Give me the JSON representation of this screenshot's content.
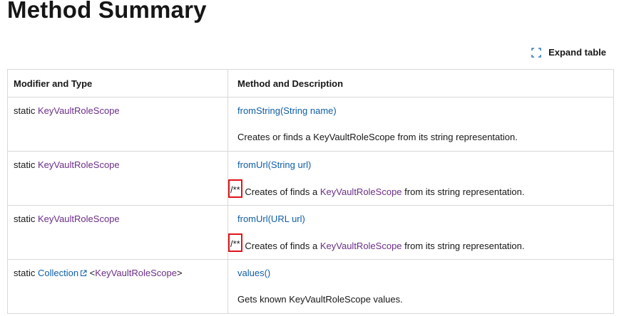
{
  "page": {
    "title": "Method Summary",
    "expand_label": "Expand table"
  },
  "table": {
    "headers": [
      "Modifier and Type",
      "Method and Description"
    ],
    "rows": [
      {
        "modifier": "static",
        "type": "KeyVaultRoleScope",
        "method": "fromString(String name)",
        "description": "Creates or finds a KeyVaultRoleScope from its string representation."
      },
      {
        "modifier": "static",
        "type": "KeyVaultRoleScope",
        "method": "fromUrl(String url)",
        "desc_prefix": "/**",
        "desc_before": " Creates of finds a ",
        "desc_link": "KeyVaultRoleScope",
        "desc_after": " from its string representation."
      },
      {
        "modifier": "static",
        "type": "KeyVaultRoleScope",
        "method": "fromUrl(URL url)",
        "desc_prefix": "/**",
        "desc_before": " Creates of finds a ",
        "desc_link": "KeyVaultRoleScope",
        "desc_after": " from its string representation."
      },
      {
        "modifier": "static",
        "type": "Collection",
        "type_open": " <",
        "type_param": "KeyVaultRoleScope",
        "type_close": ">",
        "method": "values()",
        "description": "Gets known KeyVaultRoleScope values."
      }
    ]
  },
  "colors": {
    "link": "#0f5ea8",
    "visited_type": "#6b2e87",
    "highlight_box": "#e0141b"
  },
  "icons": {
    "expand": "expand-corners-icon",
    "external": "external-link-icon"
  }
}
